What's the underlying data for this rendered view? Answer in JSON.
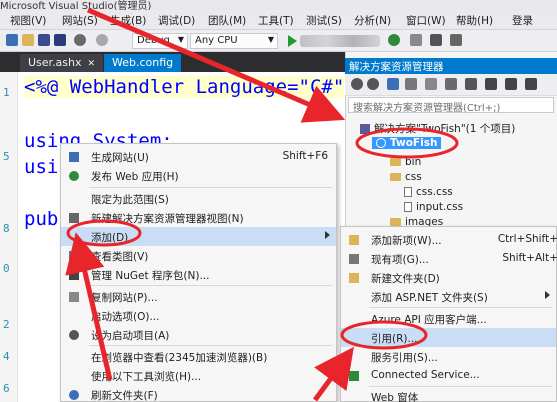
{
  "app_title": "Microsoft Visual Studio(管理员)",
  "menubar": {
    "items": [
      {
        "label": "视图(V)"
      },
      {
        "label": "网站(S)"
      },
      {
        "label": "生成(B)"
      },
      {
        "label": "调试(D)"
      },
      {
        "label": "团队(M)"
      },
      {
        "label": "工具(T)"
      },
      {
        "label": "测试(S)"
      },
      {
        "label": "分析(N)"
      },
      {
        "label": "窗口(W)"
      },
      {
        "label": "帮助(H)"
      },
      {
        "label": "登录"
      }
    ]
  },
  "toolbar": {
    "config_value": "Debug",
    "platform_value": "Any CPU"
  },
  "doc_tabs": [
    {
      "label": "User.ashx"
    },
    {
      "label": "Web.config"
    }
  ],
  "editor": {
    "line1": "<%@ WebHandler Language=\"C#\"",
    "line3": "using System;",
    "line4_partial": "usir",
    "line6_partial": "pub",
    "line_numbers": [
      "1",
      "5",
      "8",
      "0",
      "2",
      "4",
      "6"
    ]
  },
  "solution_explorer": {
    "title": "解决方案资源管理器",
    "search_placeholder": "搜索解决方案资源管理器(Ctrl+;)",
    "solution_label": "解决方案\"TwoFish\"(1 个项目)",
    "project_label": "TwoFish",
    "items": [
      {
        "label": "bin",
        "kind": "folder"
      },
      {
        "label": "css",
        "kind": "folder"
      },
      {
        "label": "css.css",
        "kind": "file"
      },
      {
        "label": "input.css",
        "kind": "file"
      },
      {
        "label": "images",
        "kind": "folder"
      }
    ]
  },
  "context_menu": {
    "items": [
      {
        "label": "生成网站(U)",
        "shortcut": "Shift+F6",
        "icon": "build-icon"
      },
      {
        "label": "发布 Web 应用(H)",
        "shortcut": "",
        "icon": "publish-icon"
      },
      {
        "label": "限定为此范围(S)",
        "shortcut": "",
        "icon": ""
      },
      {
        "label": "新建解决方案资源管理器视图(N)",
        "shortcut": "",
        "icon": "new-view-icon"
      },
      {
        "label": "添加(D)",
        "shortcut": "",
        "icon": "",
        "submenu": true,
        "highlighted": true
      },
      {
        "label": "查看类图(V)",
        "shortcut": "",
        "icon": "class-diagram-icon"
      },
      {
        "label": "管理 NuGet 程序包(N)...",
        "shortcut": "",
        "icon": "nuget-icon"
      },
      {
        "label": "复制网站(P)...",
        "shortcut": "",
        "icon": "copy-site-icon"
      },
      {
        "label": "启动选项(O)...",
        "shortcut": "",
        "icon": ""
      },
      {
        "label": "设为启动项目(A)",
        "shortcut": "",
        "icon": "gear-icon"
      },
      {
        "label": "在浏览器中查看(2345加速浏览器)(B)",
        "shortcut": "",
        "icon": ""
      },
      {
        "label": "使用以下工具浏览(H)...",
        "shortcut": "",
        "icon": ""
      },
      {
        "label": "刷新文件夹(F)",
        "shortcut": "",
        "icon": "refresh-icon"
      }
    ]
  },
  "submenu": {
    "items": [
      {
        "label": "添加新项(W)...",
        "shortcut": "Ctrl+Shift+",
        "icon": "new-item-icon"
      },
      {
        "label": "现有项(G)...",
        "shortcut": "Shift+Alt+",
        "icon": "existing-item-icon"
      },
      {
        "label": "新建文件夹(D)",
        "shortcut": "",
        "icon": "new-folder-icon"
      },
      {
        "label": "添加 ASP.NET 文件夹(S)",
        "shortcut": "",
        "icon": "",
        "submenu": true
      },
      {
        "label": "Azure API 应用客户端...",
        "shortcut": "",
        "icon": ""
      },
      {
        "label": "引用(R)...",
        "shortcut": "",
        "icon": "",
        "highlighted": true
      },
      {
        "label": "服务引用(S)...",
        "shortcut": "",
        "icon": ""
      },
      {
        "label": "Connected Service...",
        "shortcut": "",
        "icon": "connected-service-icon"
      },
      {
        "label": "Web 窗体",
        "shortcut": "",
        "icon": ""
      }
    ]
  },
  "colors": {
    "accent": "#007acc",
    "annotation_red": "#e8252b",
    "menu_highlight": "#c9def5"
  }
}
